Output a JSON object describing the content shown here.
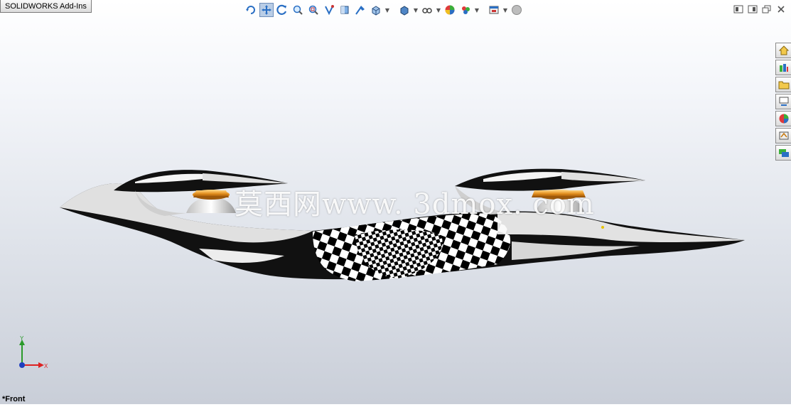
{
  "tab": {
    "label": "SOLIDWORKS Add-Ins"
  },
  "heads_up_toolbar": {
    "icons": [
      "rotate-view-icon",
      "pan-icon",
      "rotate-icon",
      "zoom-to-fit-icon",
      "zoom-to-area-icon",
      "previous-view-icon",
      "section-view-icon",
      "dynamic-annotation-icon",
      "view-orientation-icon",
      "display-style-icon",
      "hide-show-items-icon",
      "edit-appearance-icon",
      "apply-scene-icon",
      "view-settings-icon",
      "display-status-icon"
    ]
  },
  "task_pane": {
    "icons": [
      "solidworks-resources-icon",
      "design-library-icon",
      "file-explorer-icon",
      "view-palette-icon",
      "appearances-icon",
      "custom-properties-icon",
      "solidworks-forum-icon"
    ]
  },
  "viewport": {
    "watermark": "莫西网www. 3dmox. com",
    "view_label": "*Front",
    "triad": {
      "y_label": "Y",
      "x_label": "X"
    }
  }
}
